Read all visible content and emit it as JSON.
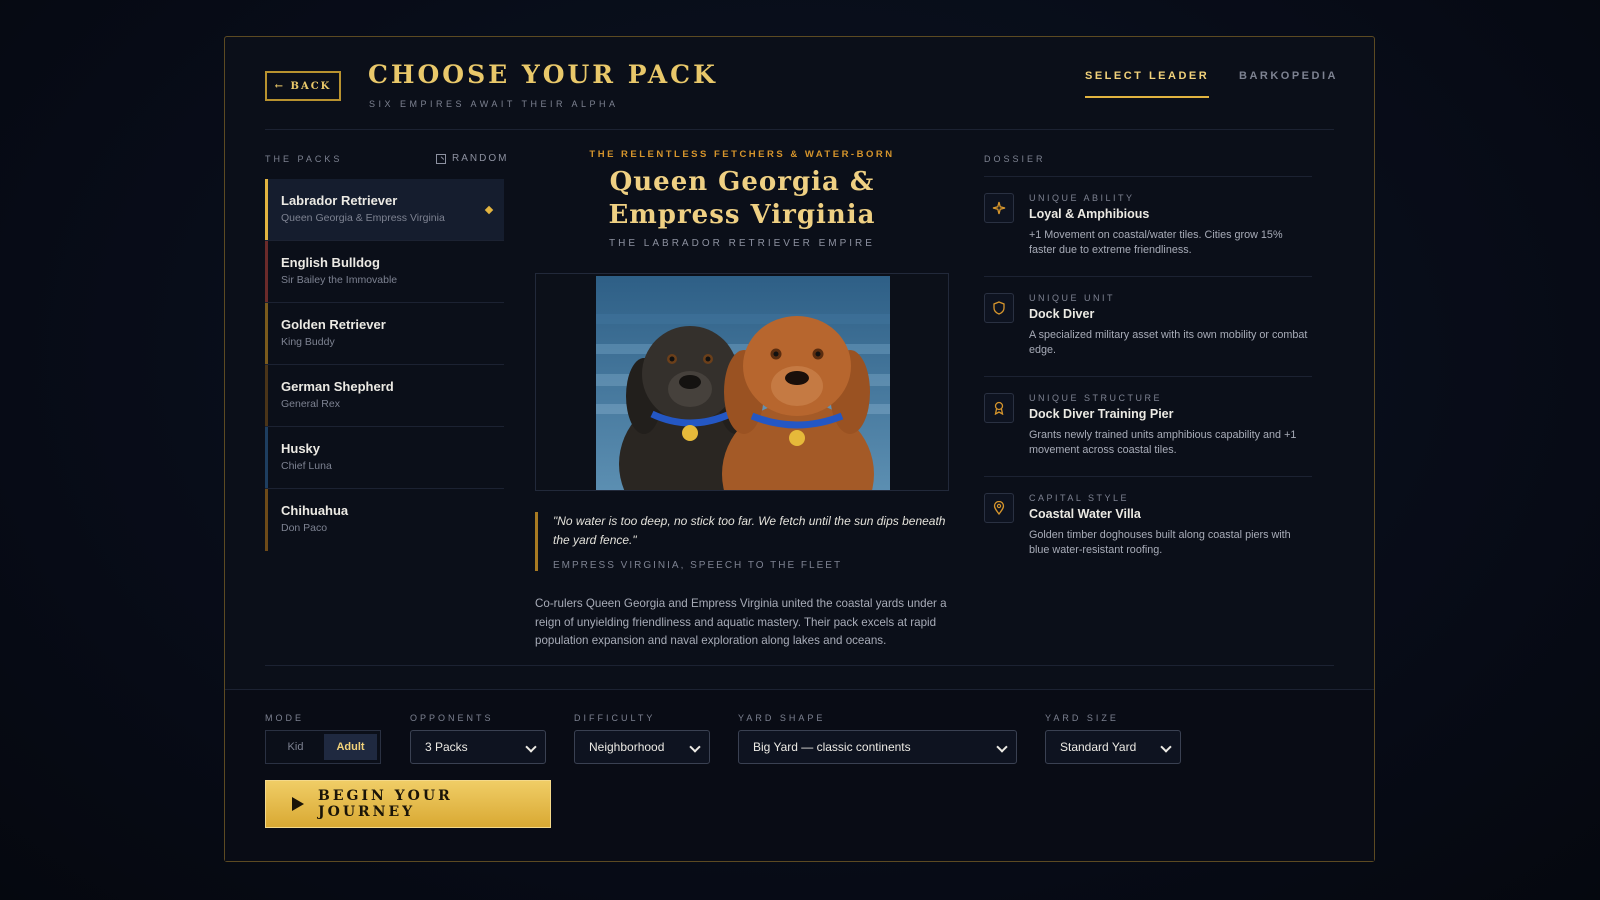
{
  "header": {
    "back_label": "← BACK",
    "title": "CHOOSE YOUR PACK",
    "subtitle": "SIX EMPIRES AWAIT THEIR ALPHA",
    "tabs": [
      {
        "label": "SELECT LEADER",
        "active": true
      },
      {
        "label": "BARKOPEDIA",
        "active": false
      }
    ]
  },
  "packs": {
    "section_label": "THE PACKS",
    "random_label": "RANDOM",
    "items": [
      {
        "name": "Labrador Retriever",
        "leader": "Queen Georgia & Empress Virginia",
        "color": "#e2b440",
        "selected": true
      },
      {
        "name": "English Bulldog",
        "leader": "Sir Bailey the Immovable",
        "color": "#6b2a2a",
        "selected": false
      },
      {
        "name": "Golden Retriever",
        "leader": "King Buddy",
        "color": "#7a5a1c",
        "selected": false
      },
      {
        "name": "German Shepherd",
        "leader": "General Rex",
        "color": "#4a3418",
        "selected": false
      },
      {
        "name": "Husky",
        "leader": "Chief Luna",
        "color": "#1e3e60",
        "selected": false
      },
      {
        "name": "Chihuahua",
        "leader": "Don Paco",
        "color": "#6e4a18",
        "selected": false
      }
    ]
  },
  "leader": {
    "tagline": "THE RELENTLESS FETCHERS & WATER-BORN",
    "name_line1": "Queen Georgia &",
    "name_line2": "Empress Virginia",
    "empire": "THE LABRADOR RETRIEVER EMPIRE",
    "quote": "\"No water is too deep, no stick too far. We fetch until the sun dips beneath the yard fence.\"",
    "quote_source": "EMPRESS VIRGINIA, SPEECH TO THE FLEET",
    "lore": "Co-rulers Queen Georgia and Empress Virginia united the coastal yards under a reign of unyielding friendliness and aquatic mastery. Their pack excels at rapid population expansion and naval exploration along lakes and oceans."
  },
  "dossier": {
    "section_label": "DOSSIER",
    "items": [
      {
        "kind": "UNIQUE ABILITY",
        "title": "Loyal & Amphibious",
        "desc": "+1 Movement on coastal/water tiles. Cities grow 15% faster due to extreme friendliness.",
        "icon": "sparkle-icon"
      },
      {
        "kind": "UNIQUE UNIT",
        "title": "Dock Diver",
        "desc": "A specialized military asset with its own mobility or combat edge.",
        "icon": "shield-icon"
      },
      {
        "kind": "UNIQUE STRUCTURE",
        "title": "Dock Diver Training Pier",
        "desc": "Grants newly trained units amphibious capability and +1 movement across coastal tiles.",
        "icon": "award-icon"
      },
      {
        "kind": "CAPITAL STYLE",
        "title": "Coastal Water Villa",
        "desc": "Golden timber doghouses built along coastal piers with blue water-resistant roofing.",
        "icon": "map-pin-icon"
      }
    ]
  },
  "settings": {
    "mode": {
      "label": "MODE",
      "options": [
        "Kid",
        "Adult"
      ],
      "selected": "Adult"
    },
    "opponents": {
      "label": "OPPONENTS",
      "value": "3 Packs"
    },
    "difficulty": {
      "label": "DIFFICULTY",
      "value": "Neighborhood"
    },
    "yard_shape": {
      "label": "YARD SHAPE",
      "value": "Big Yard — classic continents"
    },
    "yard_size": {
      "label": "YARD SIZE",
      "value": "Standard Yard"
    },
    "begin_label": "BEGIN YOUR JOURNEY"
  },
  "colors": {
    "accent": "#e2b440",
    "background": "#070b16",
    "panel": "#0b0f19"
  }
}
